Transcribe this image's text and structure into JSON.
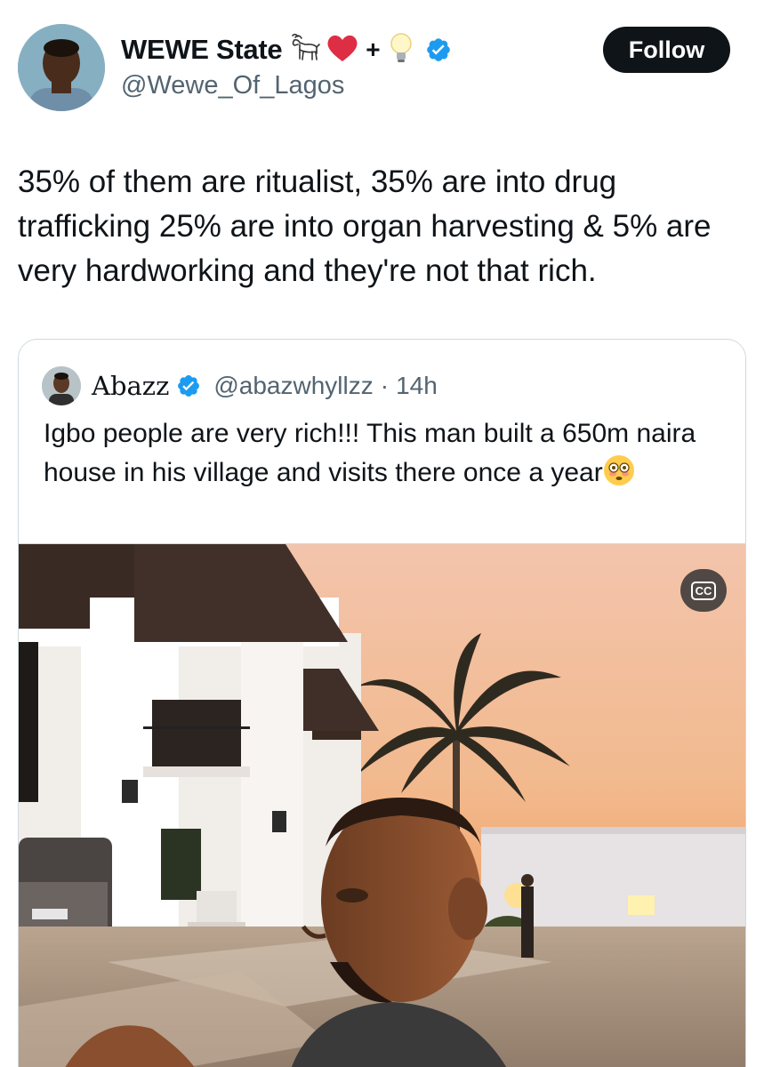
{
  "author": {
    "display_name": "WEWE State",
    "name_emojis": [
      "goat-icon",
      "heart-icon",
      "bulb-icon"
    ],
    "heart_glyph": "❤️",
    "plus_glyph": "+",
    "bulb_glyph": "💡",
    "handle": "@Wewe_Of_Lagos",
    "verified": true
  },
  "follow_button": {
    "label": "Follow"
  },
  "tweet": {
    "text": "35% of them are ritualist, 35% are into drug trafficking 25% are into organ harvesting & 5% are very hardworking and they're not that rich."
  },
  "quoted_tweet": {
    "display_name": "Abazz",
    "handle": "@abazwhyllzz",
    "separator": "·",
    "time": "14h",
    "text": "Igbo people are very rich!!! This man built a 650m naira house in his village and visits there once a year",
    "trailing_emoji": "flushed-face-icon",
    "media": {
      "type": "video",
      "cc_label": "CC"
    }
  },
  "colors": {
    "text_primary": "#0f1419",
    "text_secondary": "#536471",
    "verified_blue": "#1d9bf0",
    "border": "#cfd9de",
    "follow_bg": "#0f1419"
  }
}
